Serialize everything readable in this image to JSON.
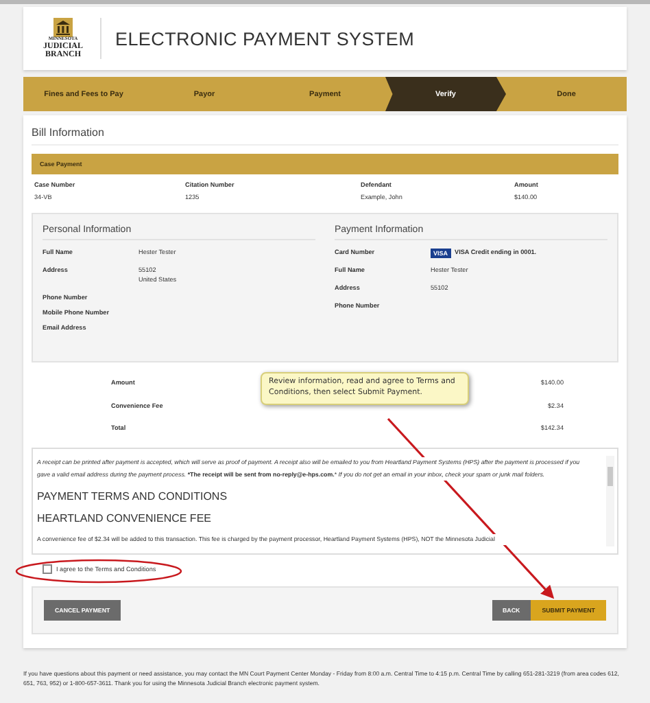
{
  "header": {
    "logo_lines": [
      "MINNESOTA",
      "JUDICIAL",
      "BRANCH"
    ],
    "title": "ELECTRONIC PAYMENT SYSTEM"
  },
  "steps": [
    {
      "label": "Fines and Fees to Pay",
      "selected": false
    },
    {
      "label": "Payor",
      "selected": false
    },
    {
      "label": "Payment",
      "selected": false
    },
    {
      "label": "Verify",
      "selected": true
    },
    {
      "label": "Done",
      "selected": false
    }
  ],
  "bill": {
    "title": "Bill Information",
    "table_title": "Case Payment",
    "columns": [
      "Case Number",
      "Citation Number",
      "Defendant",
      "Amount"
    ],
    "rows": [
      [
        "34-VB",
        "1235",
        "Example, John",
        "$140.00"
      ]
    ]
  },
  "personal": {
    "title": "Personal Information",
    "fields": [
      {
        "label": "Full Name",
        "value": "Hester Tester"
      },
      {
        "label": "Address",
        "value": "55102\nUnited States"
      },
      {
        "label": "Phone Number"
      },
      {
        "label": "Mobile Phone Number"
      },
      {
        "label": "Email Address"
      }
    ]
  },
  "payment": {
    "title": "Payment Information",
    "card_brand": "VISA",
    "fields": [
      {
        "label": "Card Number",
        "value": "VISA Credit ending in 0001.",
        "kind": "card"
      },
      {
        "label": "Full Name",
        "value": "Hester Tester",
        "kind": "text"
      },
      {
        "label": "Address",
        "value": "55102",
        "kind": "text"
      },
      {
        "label": "Phone Number",
        "kind": "text"
      }
    ]
  },
  "totals": [
    {
      "label": "Amount",
      "value": "$140.00"
    },
    {
      "label": "Convenience Fee",
      "value": "$2.34"
    },
    {
      "label": "Total",
      "value": "$142.34"
    }
  ],
  "terms": {
    "receipt_text": "*A receipt can be printed after payment is accepted, which will serve as proof of payment. A receipt also will be emailed to you from Heartland Payment Systems (HPS) after the payment is processed if you gave a valid email address during the payment process.* ***The receipt will be sent from no-reply@e-hps.com.*** *If you do not get an email in your inbox, check your spam or junk mail folders.*",
    "heading": "PAYMENT TERMS AND CONDITIONS",
    "subheading": "HEARTLAND CONVENIENCE FEE",
    "fee_text": "A convenience fee of $2.34 will be added to this transaction. This fee is charged by the payment processor, Heartland Payment Systems (HPS), NOT the Minnesota Judicial"
  },
  "agree": {
    "label": "I agree to the Terms and Conditions",
    "checked": false
  },
  "buttons": {
    "cancel": "CANCEL PAYMENT",
    "back": "BACK",
    "submit": "SUBMIT PAYMENT"
  },
  "footer": "If you have questions about this payment or need assistance, you may contact the MN Court Payment Center Monday - Friday from 8:00 a.m. Central Time to 4:15 p.m. Central Time by calling 651-281-3219 (from area codes 612, 651, 763, 952) or 1-800-657-3611. Thank you for using the Minnesota Judicial Branch electronic payment system.",
  "callout": "Review information, read and agree to Terms and Conditions, then select Submit Payment."
}
